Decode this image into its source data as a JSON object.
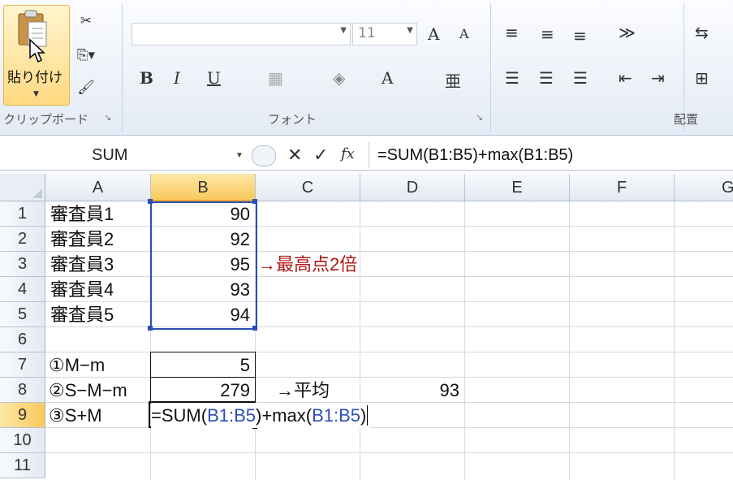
{
  "clipboard": {
    "paste_label": "貼り付け",
    "group_label": "クリップボード"
  },
  "font": {
    "name_value": "",
    "size_value": "11",
    "group_label": "フォント",
    "bold": "B",
    "italic": "I",
    "underline": "U",
    "grow": "A",
    "shrink": "A",
    "color": "A"
  },
  "alignment": {
    "group_label": "配置"
  },
  "formula_bar": {
    "name_box": "SUM",
    "cancel": "✕",
    "enter": "✓",
    "fx": "fx",
    "formula": "=SUM(B1:B5)+max(B1:B5)"
  },
  "columns": [
    "A",
    "B",
    "C",
    "D",
    "E",
    "F",
    "G"
  ],
  "rows": [
    "1",
    "2",
    "3",
    "4",
    "5",
    "6",
    "7",
    "8",
    "9",
    "10",
    "11"
  ],
  "cells": {
    "A1": "審査員1",
    "B1": "90",
    "A2": "審査員2",
    "B2": "92",
    "A3": "審査員3",
    "B3": "95",
    "C3": "→最高点2倍",
    "A4": "審査員4",
    "B4": "93",
    "A5": "審査員5",
    "B5": "94",
    "A7": "①M−m",
    "B7": "5",
    "A8": "②S−M−m",
    "B8": "279",
    "C8": "→平均",
    "D8": "93",
    "A9": "③S+M",
    "B9_edit": {
      "p1": "=SUM(",
      "p2": "B1:B5",
      "p3": ")+max(",
      "p4": "B1:B5",
      "p5": ")"
    }
  },
  "colors": {
    "accent_select": "#f9c95c",
    "ref_blue": "#2c4fb5",
    "note_red": "#b01818"
  }
}
